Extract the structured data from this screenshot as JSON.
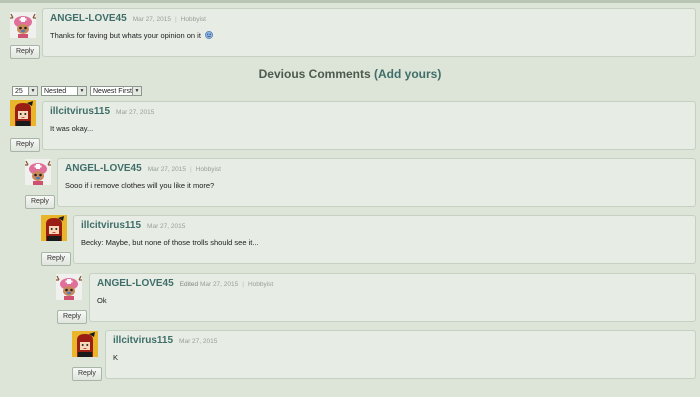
{
  "top_comment": {
    "username": "ANGEL-LOVE45",
    "date": "Mar 27, 2015",
    "rank": "Hobbyist",
    "text": "Thanks for faving but whats your opinion on it",
    "reply_label": "Reply"
  },
  "section": {
    "title": "Devious Comments",
    "add_link": "(Add yours)"
  },
  "controls": {
    "per_page": "25",
    "view_mode": "Nested",
    "sort": "Newest First"
  },
  "comments": [
    {
      "username": "illcitvirus115",
      "date": "Mar 27, 2015",
      "text": "It was okay...",
      "reply_label": "Reply"
    },
    {
      "username": "ANGEL-LOVE45",
      "date": "Mar 27, 2015",
      "rank": "Hobbyist",
      "text": "Sooo if i remove clothes will you like it more?",
      "reply_label": "Reply"
    },
    {
      "username": "illcitvirus115",
      "date": "Mar 27, 2015",
      "text": "Becky: Maybe, but none of those trolls should see it...",
      "reply_label": "Reply"
    },
    {
      "username": "ANGEL-LOVE45",
      "edited": "Edited",
      "date": "Mar 27, 2015",
      "rank": "Hobbyist",
      "text": "Ok",
      "reply_label": "Reply"
    },
    {
      "username": "illcitvirus115",
      "date": "Mar 27, 2015",
      "text": "K",
      "reply_label": "Reply"
    }
  ],
  "colors": {
    "background": "#dde4d8",
    "card": "#e7ece4",
    "username": "#3f6e6a"
  }
}
